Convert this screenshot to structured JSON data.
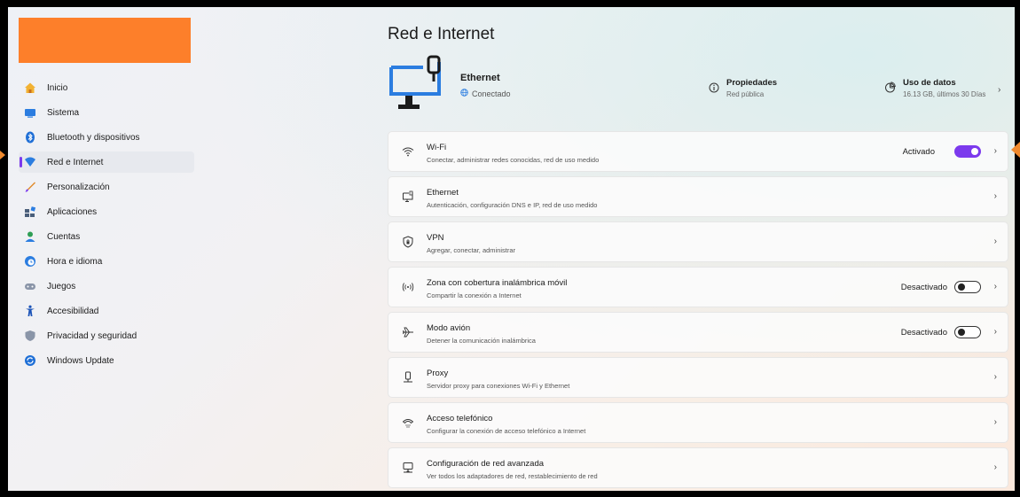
{
  "colors": {
    "accent": "#7c3aed",
    "avatar_block": "#fd7f2a",
    "pointer": "#f08a2d"
  },
  "sidebar": {
    "items": [
      {
        "label": "Inicio",
        "icon": "home-icon"
      },
      {
        "label": "Sistema",
        "icon": "system-icon"
      },
      {
        "label": "Bluetooth y dispositivos",
        "icon": "bluetooth-icon"
      },
      {
        "label": "Red e Internet",
        "icon": "network-icon",
        "active": true
      },
      {
        "label": "Personalización",
        "icon": "brush-icon"
      },
      {
        "label": "Aplicaciones",
        "icon": "apps-icon"
      },
      {
        "label": "Cuentas",
        "icon": "accounts-icon"
      },
      {
        "label": "Hora e idioma",
        "icon": "time-language-icon"
      },
      {
        "label": "Juegos",
        "icon": "gamepad-icon"
      },
      {
        "label": "Accesibilidad",
        "icon": "accessibility-icon"
      },
      {
        "label": "Privacidad y seguridad",
        "icon": "shield-icon"
      },
      {
        "label": "Windows Update",
        "icon": "update-icon"
      }
    ]
  },
  "page": {
    "title": "Red e Internet"
  },
  "header": {
    "connection_title": "Ethernet",
    "connection_status": "Conectado",
    "properties_title": "Propiedades",
    "properties_sub": "Red pública",
    "usage_title": "Uso de datos",
    "usage_sub": "16.13 GB, últimos 30 Días"
  },
  "rows": [
    {
      "title": "Wi-Fi",
      "sub": "Conectar, administrar redes conocidas, red de uso medido",
      "icon": "wifi-icon",
      "state": "Activado",
      "toggle": "on"
    },
    {
      "title": "Ethernet",
      "sub": "Autenticación, configuración DNS e IP, red de uso medido",
      "icon": "ethernet-icon"
    },
    {
      "title": "VPN",
      "sub": "Agregar, conectar, administrar",
      "icon": "vpn-shield-icon"
    },
    {
      "title": "Zona con cobertura inalámbrica móvil",
      "sub": "Compartir la conexión a Internet",
      "icon": "hotspot-icon",
      "state": "Desactivado",
      "toggle": "off"
    },
    {
      "title": "Modo avión",
      "sub": "Detener la comunicación inalámbrica",
      "icon": "airplane-icon",
      "state": "Desactivado",
      "toggle": "off"
    },
    {
      "title": "Proxy",
      "sub": "Servidor proxy para conexiones Wi-Fi y Ethernet",
      "icon": "proxy-icon"
    },
    {
      "title": "Acceso telefónico",
      "sub": "Configurar la conexión de acceso telefónico a Internet",
      "icon": "dialup-icon"
    },
    {
      "title": "Configuración de red avanzada",
      "sub": "Ver todos los adaptadores de red, restablecimiento de red",
      "icon": "advanced-network-icon"
    }
  ]
}
